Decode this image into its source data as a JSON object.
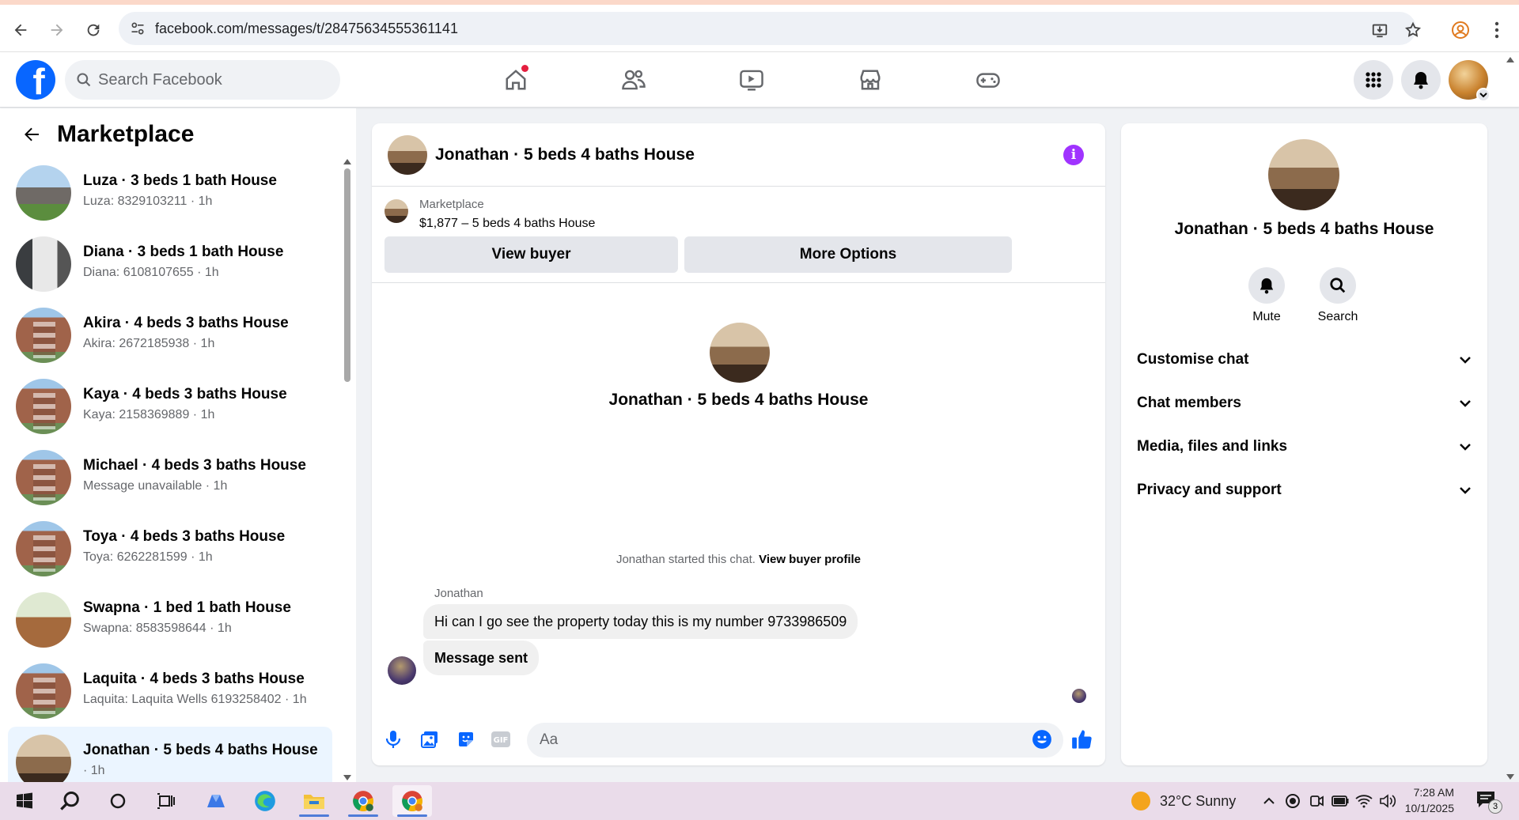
{
  "browser": {
    "url": "facebook.com/messages/t/28475634555361141"
  },
  "fb": {
    "search_placeholder": "Search Facebook"
  },
  "sidebar": {
    "title": "Marketplace",
    "conversations": [
      {
        "name": "Luza · 3 beds 1 bath House",
        "sub": "Luza: 8329103211 · 1h",
        "thumb": "suburb"
      },
      {
        "name": "Diana · 3 beds 1 bath House",
        "sub": "Diana: 6108107655 · 1h",
        "thumb": "modern"
      },
      {
        "name": "Akira · 4 beds 3 baths House",
        "sub": "Akira: 2672185938 · 1h",
        "thumb": "brick"
      },
      {
        "name": "Kaya · 4 beds 3 baths House",
        "sub": "Kaya: 2158369889 · 1h",
        "thumb": "brick"
      },
      {
        "name": "Michael · 4 beds 3 baths House",
        "sub": "Message unavailable · 1h",
        "thumb": "brick"
      },
      {
        "name": "Toya · 4 beds 3 baths House",
        "sub": "Toya: 6262281599 · 1h",
        "thumb": "brick"
      },
      {
        "name": "Swapna · 1 bed 1 bath House",
        "sub": "Swapna: 8583598644 · 1h",
        "thumb": "green"
      },
      {
        "name": "Laquita · 4 beds 3 baths House",
        "sub": "Laquita: Laquita Wells 6193258402 · 1h",
        "thumb": "brick"
      },
      {
        "name": "Jonathan · 5 beds 4 baths House",
        "sub": " · 1h",
        "thumb": "room"
      }
    ]
  },
  "chat": {
    "title": "Jonathan · 5 beds 4 baths House",
    "marketplace_label": "Marketplace",
    "listing": "$1,877 – 5 beds 4 baths House",
    "view_buyer_label": "View buyer",
    "more_options_label": "More Options",
    "center_name": "Jonathan · 5 beds 4 baths House",
    "started_text": "Jonathan started this chat.",
    "view_buyer_profile": "View buyer profile",
    "sender_name": "Jonathan",
    "messages": [
      "Hi can I go see the property today this is my number 9733986509",
      "Message sent"
    ],
    "input_placeholder": "Aa"
  },
  "info": {
    "name": "Jonathan · 5 beds 4 baths House",
    "mute_label": "Mute",
    "search_label": "Search",
    "sections": [
      "Customise chat",
      "Chat members",
      "Media, files and links",
      "Privacy and support"
    ]
  },
  "taskbar": {
    "weather": "32°C  Sunny",
    "time": "7:28 AM",
    "date": "10/1/2025",
    "notifications": "3"
  },
  "colors": {
    "fb_blue": "#0866ff",
    "info_purple": "#a033ff",
    "active_row": "#ebf5ff"
  }
}
